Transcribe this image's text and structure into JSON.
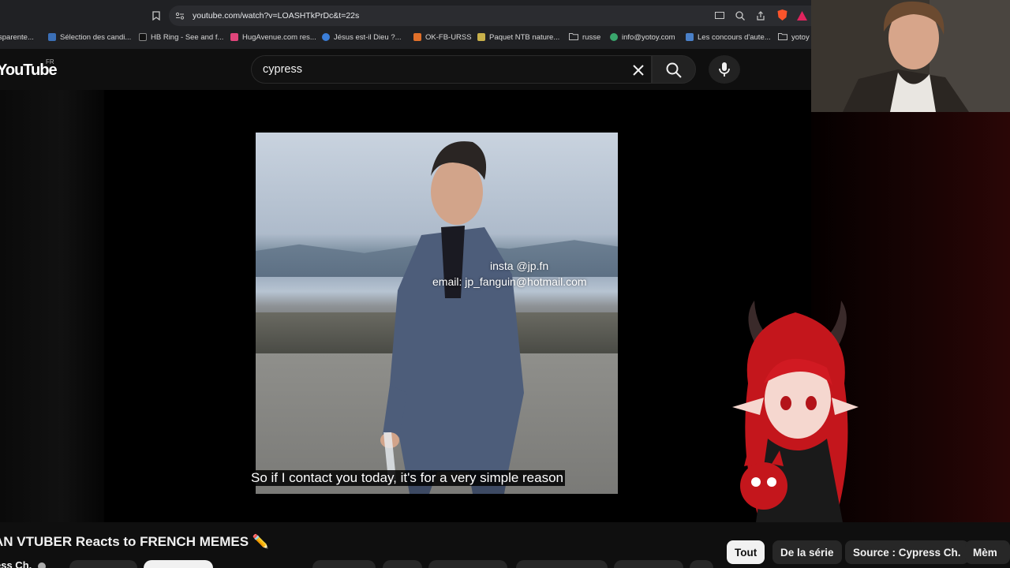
{
  "browser": {
    "url": "youtube.com/watch?v=LOASHTkPrDc&t=22s",
    "bookmarks": [
      {
        "label": "sparente...",
        "color": "#4a90d9"
      },
      {
        "label": "Sélection des candi...",
        "color": "#3b6fb6"
      },
      {
        "label": "HB Ring - See and f...",
        "color": "#222222"
      },
      {
        "label": "HugAvenue.com res...",
        "color": "#e0457b"
      },
      {
        "label": "Jésus est-il Dieu ?...",
        "color": "#3b7ed8"
      },
      {
        "label": "OK-FB-URSS",
        "color": "#e0702a"
      },
      {
        "label": "Paquet NTB nature...",
        "color": "#c8b04a"
      },
      {
        "label": "russe",
        "color": "#9aa0a6"
      },
      {
        "label": "info@yotoy.com",
        "color": "#3aa76d"
      },
      {
        "label": "Les concours d'aute...",
        "color": "#4a80c8"
      },
      {
        "label": "yotoy",
        "color": "#9aa0a6"
      }
    ]
  },
  "youtube": {
    "logo_text": "YouTube",
    "country_code": "FR",
    "search_value": "cypress"
  },
  "video": {
    "meme_text_1": "insta @jp.fn",
    "meme_text_2": "email: jp_fanguin@hotmail.com",
    "subtitle": "So if I contact you today, it's for a very simple reason"
  },
  "page": {
    "video_title": "AN VTUBER Reacts to FRENCH MEMES ✏️",
    "channel_name": "ess Ch.",
    "chips": [
      "Tout",
      "De la série",
      "Source : Cypress Ch.",
      "Mèm"
    ]
  },
  "colors": {
    "accent": "#ff0000",
    "chip_active": "#f1f1f1"
  }
}
